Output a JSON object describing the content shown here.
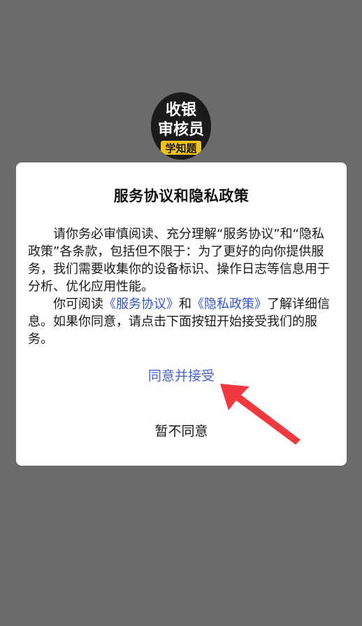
{
  "background_color": "#6b6b6b",
  "logo": {
    "line1": "收银",
    "line2": "审核员",
    "badge": "学知题"
  },
  "dialog": {
    "title": "服务协议和隐私政策",
    "para1": "请你务必审慎阅读、充分理解“服务协议”和“隐私政策”各条款，包括但不限于：为了更好的向你提供服务，我们需要收集你的设备标识、操作日志等信息用于分析、优化应用性能。",
    "para2_prefix": "你可阅读",
    "link_service": "《服务协议》",
    "para2_and": "和",
    "link_privacy": "《隐私政策》",
    "para2_suffix": "了解详细信息。如果你同意，请点击下面按钮开始接受我们的服务。",
    "agree_label": "同意并接受",
    "disagree_label": "暂不同意"
  },
  "colors": {
    "agree": "#4a63c9",
    "link": "#3355cc",
    "arrow": "#f0383f"
  },
  "icons": {
    "annotation": "red-arrow-icon"
  }
}
